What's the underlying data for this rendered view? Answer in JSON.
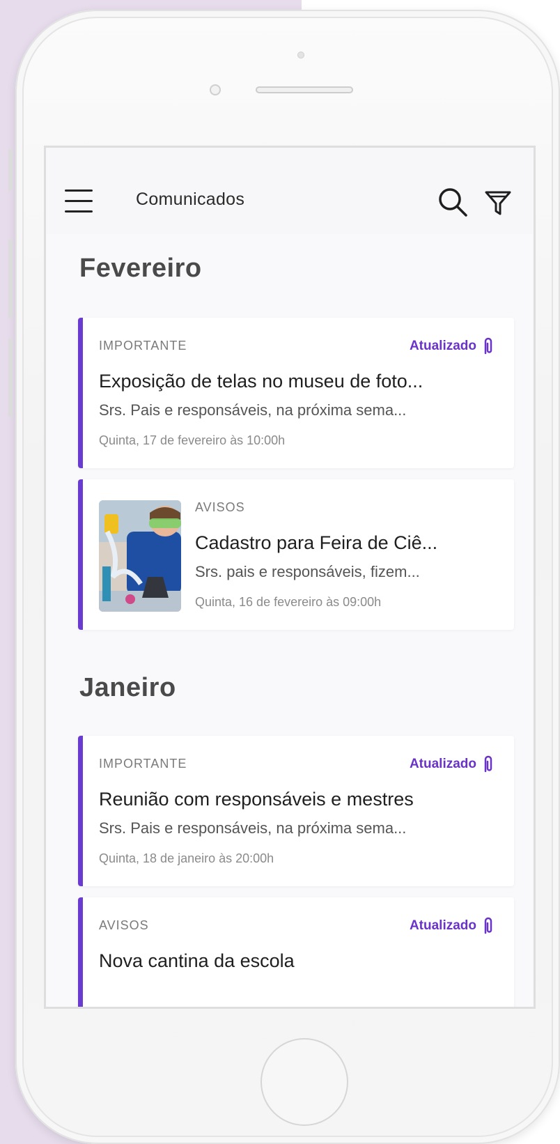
{
  "app": {
    "title": "Comunicados"
  },
  "sections": [
    {
      "heading": "Fevereiro",
      "cards": [
        {
          "category": "IMPORTANTE",
          "badge": "Atualizado",
          "title": "Exposição de telas no museu de foto...",
          "description": "Srs. Pais e responsáveis, na próxima sema...",
          "date": "Quinta, 17 de fevereiro às 10:00h"
        },
        {
          "category": "AVISOS",
          "title": "Cadastro para Feira de Ciê...",
          "description": "Srs. pais e responsáveis, fizem...",
          "date": "Quinta, 16 de fevereiro às 09:00h"
        }
      ]
    },
    {
      "heading": "Janeiro",
      "cards": [
        {
          "category": "IMPORTANTE",
          "badge": "Atualizado",
          "title": "Reunião com responsáveis e mestres",
          "description": "Srs. Pais e responsáveis, na próxima sema...",
          "date": "Quinta, 18 de janeiro às 20:00h"
        },
        {
          "category": "AVISOS",
          "badge": "Atualizado",
          "title": "Nova cantina da escola"
        }
      ]
    }
  ],
  "icons": {
    "menu": "menu-icon",
    "search": "search-icon",
    "filter": "filter-icon",
    "attachment": "paperclip-icon"
  },
  "colors": {
    "accent": "#6a3bd1",
    "badge": "#6a33c8",
    "background": "#e6dcec"
  }
}
